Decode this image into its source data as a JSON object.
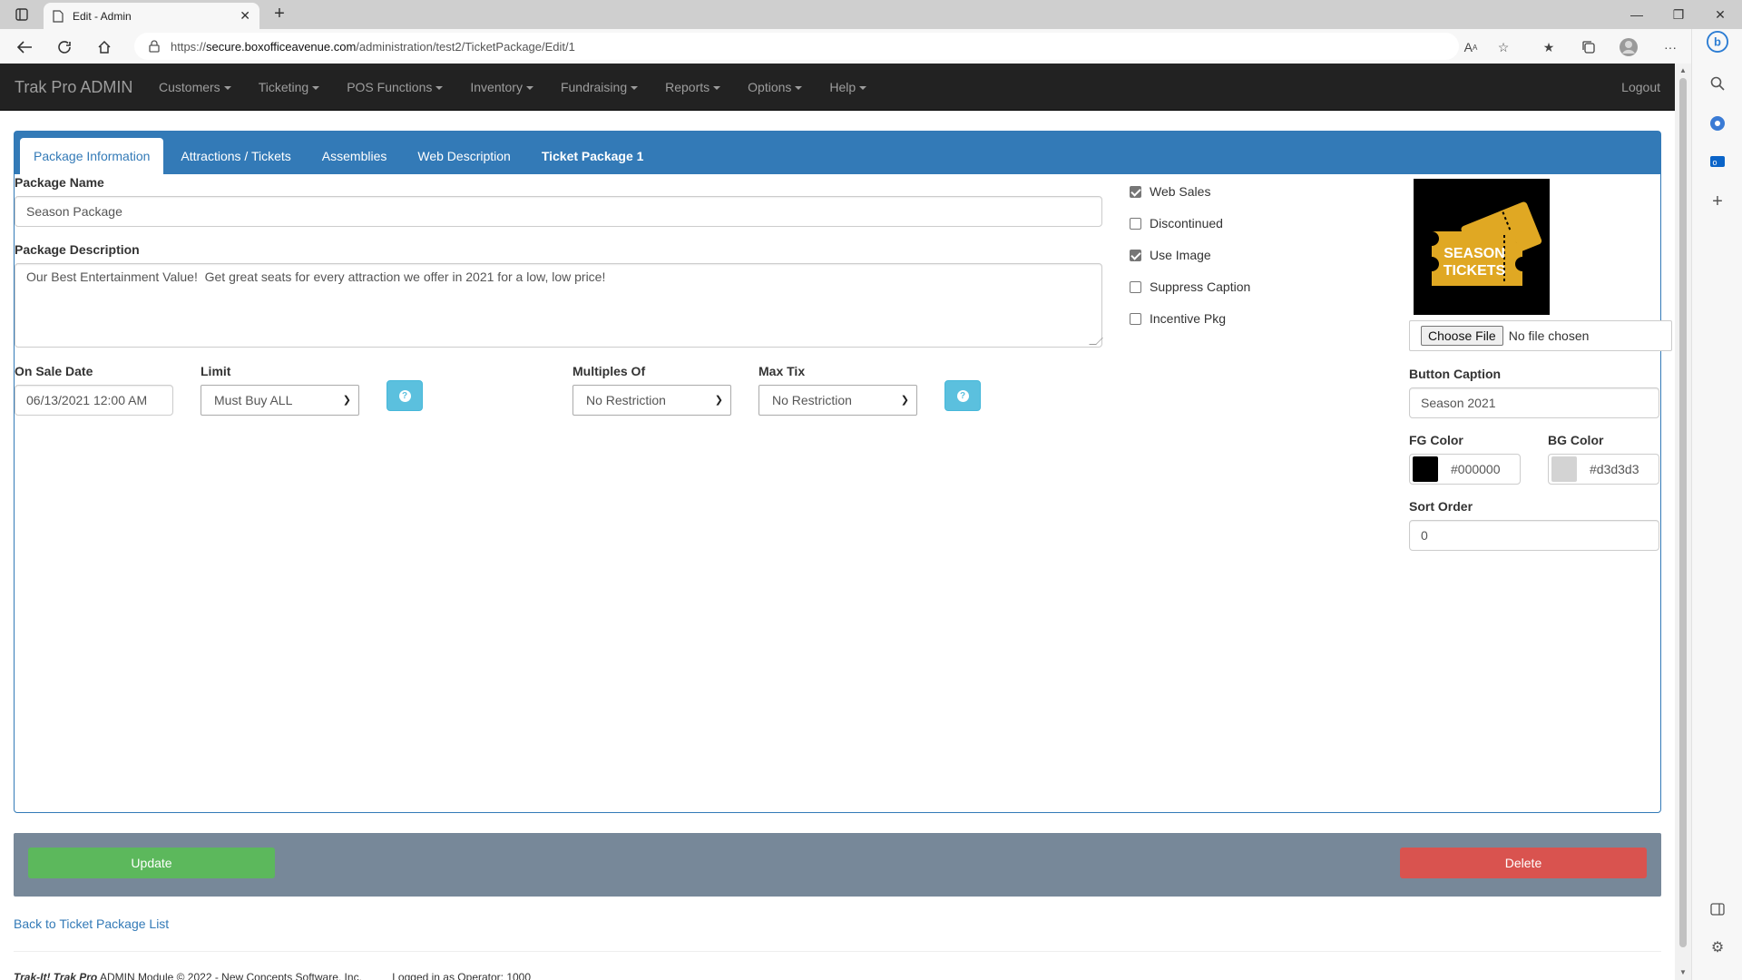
{
  "browser": {
    "tab_title": "Edit - Admin",
    "url_prefix": "https://",
    "url_host": "secure.boxofficeavenue.com",
    "url_path": "/administration/test2/TicketPackage/Edit/1"
  },
  "navbar": {
    "brand": "Trak Pro ADMIN",
    "menu": [
      "Customers",
      "Ticketing",
      "POS Functions",
      "Inventory",
      "Fundraising",
      "Reports",
      "Options",
      "Help"
    ],
    "logout": "Logout"
  },
  "tabs": [
    "Package Information",
    "Attractions / Tickets",
    "Assemblies",
    "Web Description",
    "Ticket Package 1"
  ],
  "form": {
    "package_name_label": "Package Name",
    "package_name": "Season Package",
    "package_description_label": "Package Description",
    "package_description": "Our Best Entertainment Value!  Get great seats for every attraction we offer in 2021 for a low, low price!",
    "on_sale_label": "On Sale Date",
    "on_sale_value": "06/13/2021 12:00 AM",
    "limit_label": "Limit",
    "limit_value": "Must Buy ALL",
    "multiples_label": "Multiples Of",
    "multiples_value": "No Restriction",
    "maxtix_label": "Max Tix",
    "maxtix_value": "No Restriction",
    "help_glyph": "?"
  },
  "checkboxes": [
    {
      "label": "Web Sales",
      "checked": true
    },
    {
      "label": "Discontinued",
      "checked": false
    },
    {
      "label": "Use Image",
      "checked": true
    },
    {
      "label": "Suppress Caption",
      "checked": false
    },
    {
      "label": "Incentive Pkg",
      "checked": false
    }
  ],
  "image": {
    "line1": "SEASON",
    "line2": "TICKETS",
    "ticket_color": "#e0a823"
  },
  "file_input": {
    "button": "Choose File",
    "status": "No file chosen"
  },
  "side": {
    "button_caption_label": "Button Caption",
    "button_caption": "Season 2021",
    "fg_label": "FG Color",
    "fg_value": "#000000",
    "bg_label": "BG Color",
    "bg_value": "#d3d3d3",
    "sort_label": "Sort Order",
    "sort_value": "0"
  },
  "actions": {
    "update": "Update",
    "delete": "Delete"
  },
  "back_link": "Back to Ticket Package List",
  "footer": {
    "brand": "Trak-It! Trak Pro",
    "text": " ADMIN Module © 2022 - New Concepts Software, Inc.",
    "login": "Logged in as Operator: 1000"
  },
  "colors": {
    "primary": "#337ab7",
    "success": "#5cb85c",
    "danger": "#d9534f",
    "info": "#5bc0de",
    "navbar": "#222222",
    "action_bar": "#778899"
  }
}
